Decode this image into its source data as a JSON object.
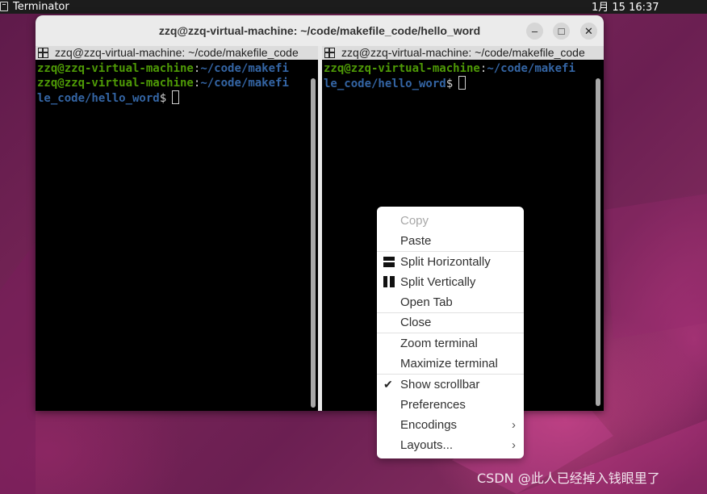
{
  "topbar": {
    "app_name": "Terminator",
    "clock": "1月 15  16:37"
  },
  "window": {
    "title": "zzq@zzq-virtual-machine: ~/code/makefile_code/hello_word",
    "buttons": {
      "minimize": "–",
      "maximize": "□",
      "close": "✕"
    }
  },
  "panes": {
    "left": {
      "header": "zzq@zzq-virtual-machine: ~/code/makefile_code",
      "lines": [
        {
          "user": "zzq@zzq-virtual-machine",
          "sep": ":",
          "path": "~/code/makefi"
        },
        {
          "user": "zzq@zzq-virtual-machine",
          "sep": ":",
          "path": "~/code/makefi"
        },
        {
          "path": "le_code/hello_word",
          "prompt": "$"
        }
      ]
    },
    "right": {
      "header": "zzq@zzq-virtual-machine: ~/code/makefile_code",
      "lines": [
        {
          "user": "zzq@zzq-virtual-machine",
          "sep": ":",
          "path": "~/code/makefi"
        },
        {
          "path": "le_code/hello_word",
          "prompt": "$"
        }
      ]
    }
  },
  "context_menu": {
    "items": [
      {
        "label": "Copy",
        "enabled": false
      },
      {
        "label": "Paste"
      },
      {
        "label": "Split Horizontally",
        "icon": "split-horizontal-icon"
      },
      {
        "label": "Split Vertically",
        "icon": "split-vertical-icon"
      },
      {
        "label": "Open Tab"
      },
      {
        "label": "Close"
      },
      {
        "label": "Zoom terminal"
      },
      {
        "label": "Maximize terminal"
      },
      {
        "label": "Show scrollbar",
        "checked": true
      },
      {
        "label": "Preferences"
      },
      {
        "label": "Encodings",
        "submenu": true
      },
      {
        "label": "Layouts...",
        "submenu": true
      }
    ]
  },
  "watermark": "CSDN @此人已经掉入钱眼里了"
}
